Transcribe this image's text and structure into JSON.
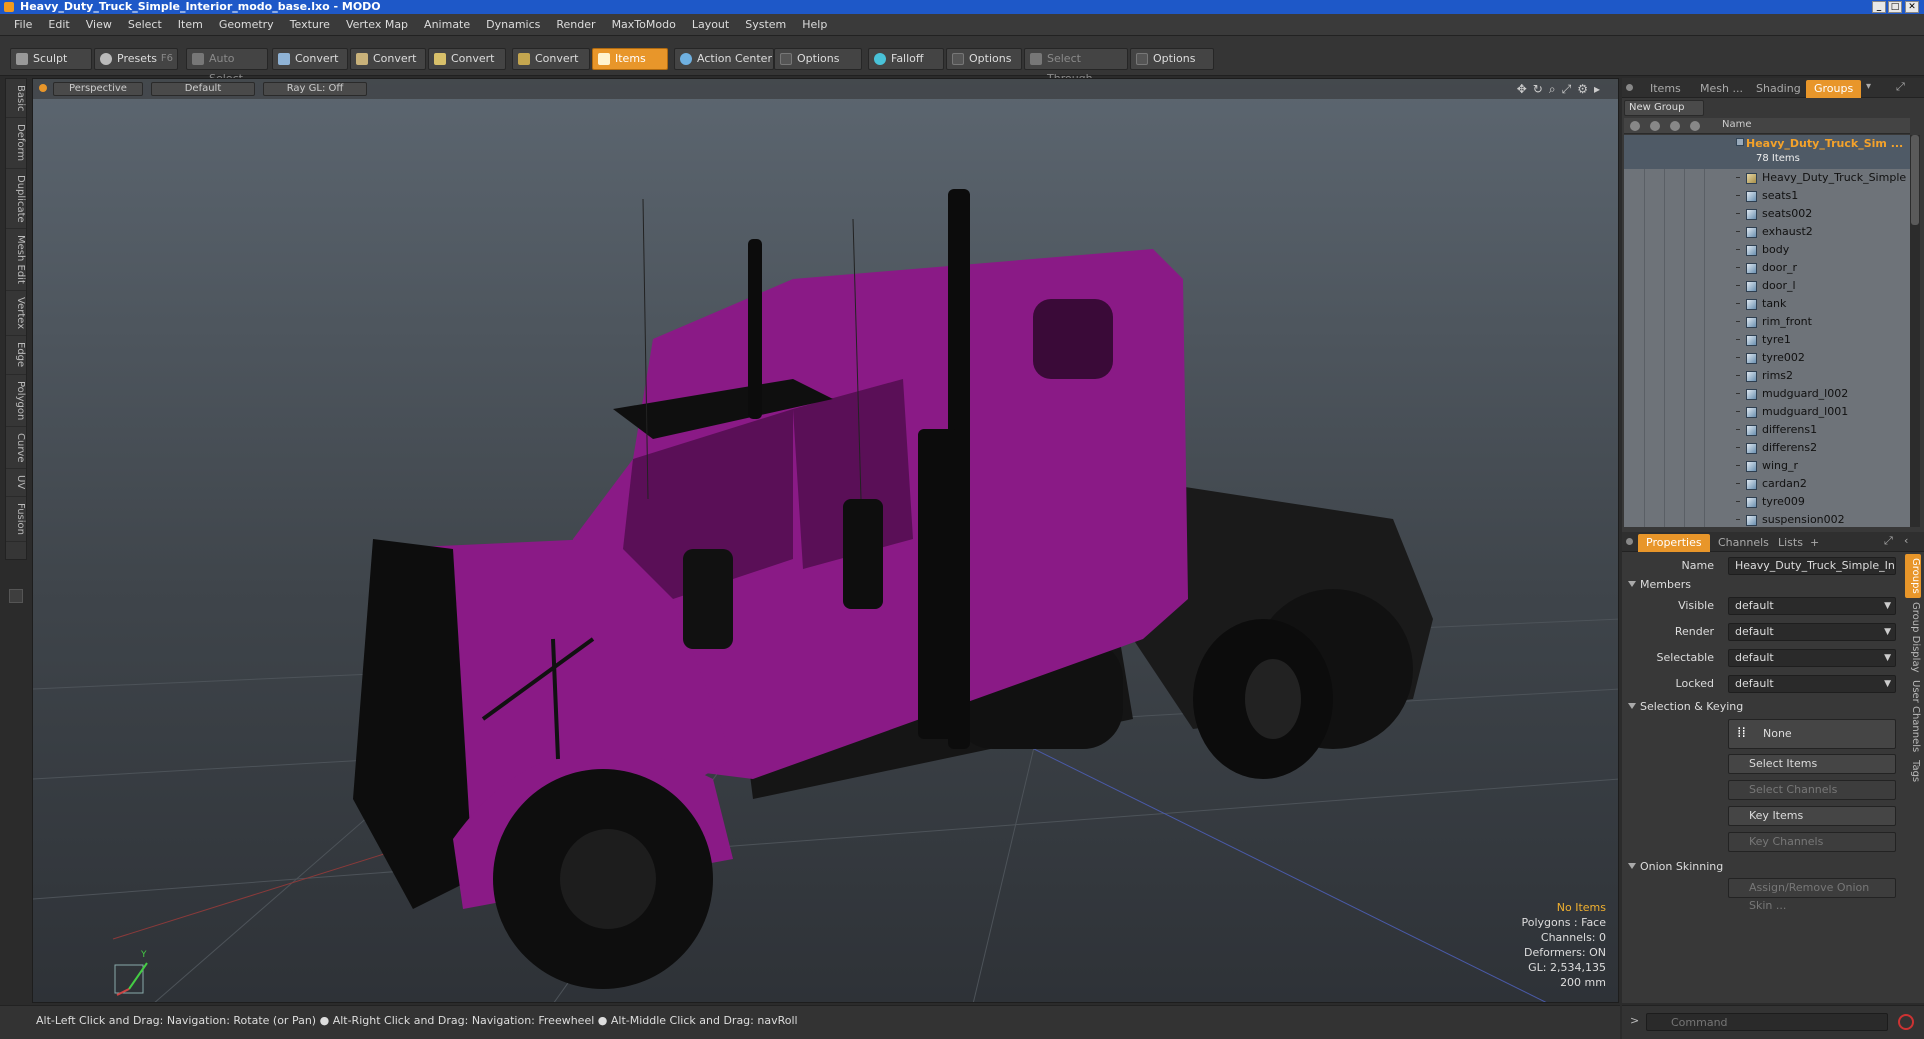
{
  "title": "Heavy_Duty_Truck_Simple_Interior_modo_base.lxo - MODO",
  "menu": [
    "File",
    "Edit",
    "View",
    "Select",
    "Item",
    "Geometry",
    "Texture",
    "Vertex Map",
    "Animate",
    "Dynamics",
    "Render",
    "MaxToModo",
    "Layout",
    "System",
    "Help"
  ],
  "toolbar": {
    "sculpt": "Sculpt",
    "presets": "Presets",
    "presets_key": "F6",
    "auto_select": "Auto Select",
    "convert1": "Convert",
    "convert2": "Convert",
    "convert3": "Convert",
    "convert4": "Convert",
    "items": "Items",
    "action_center": "Action Center",
    "options1": "Options",
    "falloff": "Falloff",
    "options2": "Options",
    "select_through": "Select Through",
    "options3": "Options"
  },
  "left_tabs": [
    "Basic",
    "Deform",
    "Duplicate",
    "Mesh Edit",
    "Vertex",
    "Edge",
    "Polygon",
    "Curve",
    "UV",
    "Fusion"
  ],
  "viewport": {
    "perspective": "Perspective",
    "shading": "Default",
    "raygl": "Ray GL: Off",
    "info": {
      "items": "No Items",
      "polygons": "Polygons : Face",
      "channels": "Channels: 0",
      "deformers": "Deformers: ON",
      "gl": "GL: 2,534,135",
      "scale": "200 mm"
    },
    "axis_label": "Y"
  },
  "outliner": {
    "tabs": [
      "Items",
      "Mesh ...",
      "Shading",
      "Groups"
    ],
    "active_tab": "Groups",
    "new_group": "New Group",
    "name_col": "Name",
    "group_title": "Heavy_Duty_Truck_Sim ...",
    "group_count": "78 Items",
    "items": [
      "Heavy_Duty_Truck_Simple ...",
      "seats1",
      "seats002",
      "exhaust2",
      "body",
      "door_r",
      "door_l",
      "tank",
      "rim_front",
      "tyre1",
      "tyre002",
      "rims2",
      "mudguard_l002",
      "mudguard_l001",
      "differens1",
      "differens2",
      "wing_r",
      "cardan2",
      "tyre009",
      "suspension002"
    ]
  },
  "properties": {
    "tabs": [
      "Properties",
      "Channels",
      "Lists",
      "+"
    ],
    "name_label": "Name",
    "name_value": "Heavy_Duty_Truck_Simple_Inter",
    "members": "Members",
    "visible_label": "Visible",
    "visible_value": "default",
    "render_label": "Render",
    "render_value": "default",
    "selectable_label": "Selectable",
    "selectable_value": "default",
    "locked_label": "Locked",
    "locked_value": "default",
    "selection_keying": "Selection & Keying",
    "none": "None",
    "select_items": "Select Items",
    "select_channels": "Select Channels",
    "key_items": "Key Items",
    "key_channels": "Key Channels",
    "onion": "Onion Skinning",
    "assign_onion": "Assign/Remove Onion Skin ...",
    "vtabs": [
      "Groups",
      "Group Display",
      "User Channels",
      "Tags"
    ]
  },
  "status": "Alt-Left Click and Drag: Navigation: Rotate (or Pan) ● Alt-Right Click and Drag: Navigation: Freewheel ● Alt-Middle Click and Drag: navRoll",
  "command_placeholder": "Command",
  "colors": {
    "accent": "#e8962a",
    "truck": "#8a1a86",
    "title": "#1e58c8"
  }
}
